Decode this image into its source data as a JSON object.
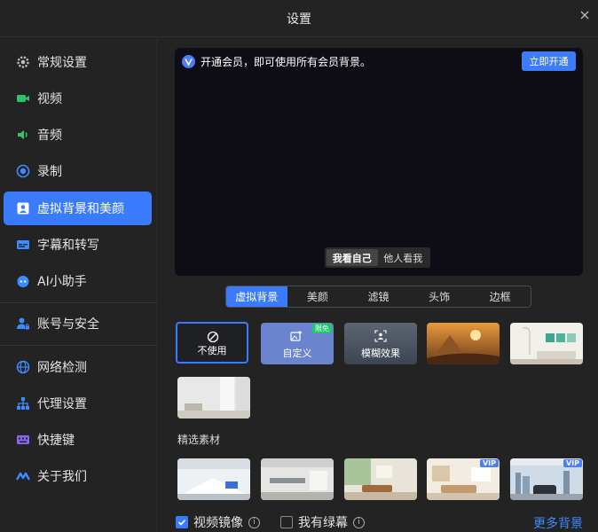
{
  "window": {
    "title": "设置"
  },
  "sidebar": {
    "items": [
      {
        "label": "常规设置",
        "icon": "gear-icon"
      },
      {
        "label": "视频",
        "icon": "video-icon"
      },
      {
        "label": "音频",
        "icon": "speaker-icon"
      },
      {
        "label": "录制",
        "icon": "record-icon"
      },
      {
        "label": "虚拟背景和美颜",
        "icon": "portrait-icon",
        "active": true
      },
      {
        "label": "字幕和转写",
        "icon": "subtitles-icon"
      },
      {
        "label": "AI小助手",
        "icon": "ai-assistant-icon"
      },
      {
        "label": "账号与安全",
        "icon": "account-security-icon"
      },
      {
        "label": "网络检测",
        "icon": "globe-icon"
      },
      {
        "label": "代理设置",
        "icon": "network-tree-icon"
      },
      {
        "label": "快捷键",
        "icon": "keyboard-icon"
      },
      {
        "label": "关于我们",
        "icon": "logo-icon"
      }
    ]
  },
  "preview": {
    "banner_text": "开通会员，即可使用所有会员背景。",
    "open_button": "立即开通",
    "view_self": "我看自己",
    "view_others": "他人看我"
  },
  "tabs": [
    "虚拟背景",
    "美颜",
    "滤镜",
    "头饰",
    "边框"
  ],
  "backgrounds": {
    "none_label": "不使用",
    "custom_label": "自定义",
    "custom_badge": "限免",
    "blur_label": "模糊效果"
  },
  "featured": {
    "title": "精选素材",
    "vip_badge": "VIP"
  },
  "footer": {
    "mirror_label": "视频镜像",
    "mirror_checked": true,
    "greenscreen_label": "我有绿幕",
    "greenscreen_checked": false,
    "more_link": "更多背景"
  },
  "colors": {
    "accent": "#3a7bfd",
    "background": "#232323",
    "limited_badge": "#1ec96a"
  }
}
